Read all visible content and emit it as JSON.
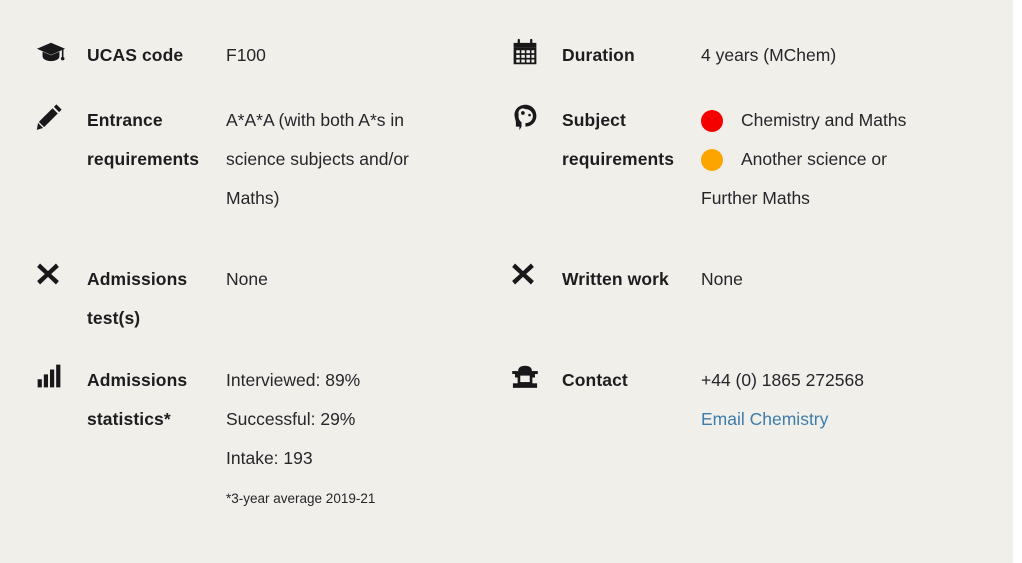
{
  "theme": {
    "card_background": "#f1efea",
    "page_background": "#ffffff",
    "text_color": "#26262a",
    "label_color": "#1d1d1f",
    "link_color": "#3d7cab",
    "dot_red": "#f50000",
    "dot_amber": "#fca400"
  },
  "facts": {
    "ucas": {
      "icon": "graduation-cap-icon",
      "label": "UCAS code",
      "value": "F100"
    },
    "duration": {
      "icon": "calendar-icon",
      "label": "Duration",
      "value": "4 years (MChem)"
    },
    "entrance": {
      "icon": "pencil-icon",
      "label": "Entrance requirements",
      "value": "A*A*A (with both A*s in science subjects and/or Maths)"
    },
    "subject": {
      "icon": "head-gears-icon",
      "label": "Subject requirements",
      "requirements": [
        {
          "dot_color": "#f50000",
          "text": "Chemistry and Maths"
        },
        {
          "dot_color": "#fca400",
          "text": "Another science or"
        }
      ],
      "continuation": "Further Maths"
    },
    "admissions_test": {
      "icon": "cross-icon",
      "label": "Admissions test(s)",
      "value": "None"
    },
    "written_work": {
      "icon": "cross-icon",
      "label": "Written work",
      "value": "None"
    },
    "admissions_statistics": {
      "icon": "bar-chart-icon",
      "label": "Admissions statistics*",
      "lines": [
        "Interviewed: 89%",
        "Successful: 29%",
        "Intake: 193"
      ],
      "footnote": "*3-year average 2019-21"
    },
    "contact": {
      "icon": "telephone-icon",
      "label": "Contact",
      "phone": "+44 (0) 1865 272568",
      "email_link_label": "Email Chemistry"
    }
  }
}
